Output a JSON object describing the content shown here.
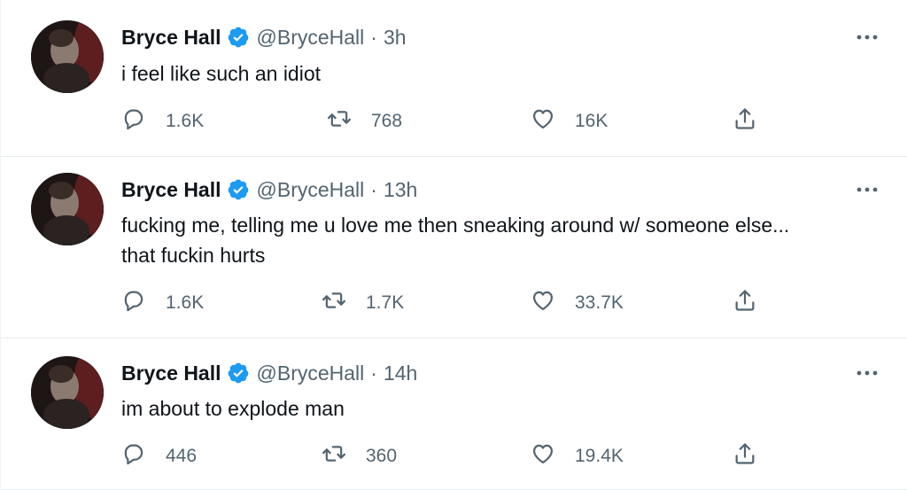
{
  "tweets": [
    {
      "name": "Bryce Hall",
      "handle": "@BryceHall",
      "separator": "·",
      "time": "3h",
      "text": "i feel like such an idiot",
      "replies": "1.6K",
      "retweets": "768",
      "likes": "16K"
    },
    {
      "name": "Bryce Hall",
      "handle": "@BryceHall",
      "separator": "·",
      "time": "13h",
      "text_line1": "fucking me, telling me u love me then sneaking around w/ someone else...",
      "text_line2": "that fuckin hurts",
      "replies": "1.6K",
      "retweets": "1.7K",
      "likes": "33.7K"
    },
    {
      "name": "Bryce Hall",
      "handle": "@BryceHall",
      "separator": "·",
      "time": "14h",
      "text": "im about to explode man",
      "replies": "446",
      "retweets": "360",
      "likes": "19.4K"
    }
  ],
  "icons": {
    "verified": "verified-badge-icon",
    "more": "more-horizontal-icon",
    "reply": "reply-icon",
    "retweet": "retweet-icon",
    "like": "heart-icon",
    "share": "share-icon"
  },
  "colors": {
    "text": "#0f1419",
    "secondary": "#536471",
    "verified": "#1d9bf0",
    "divider": "#e6ecf0"
  }
}
